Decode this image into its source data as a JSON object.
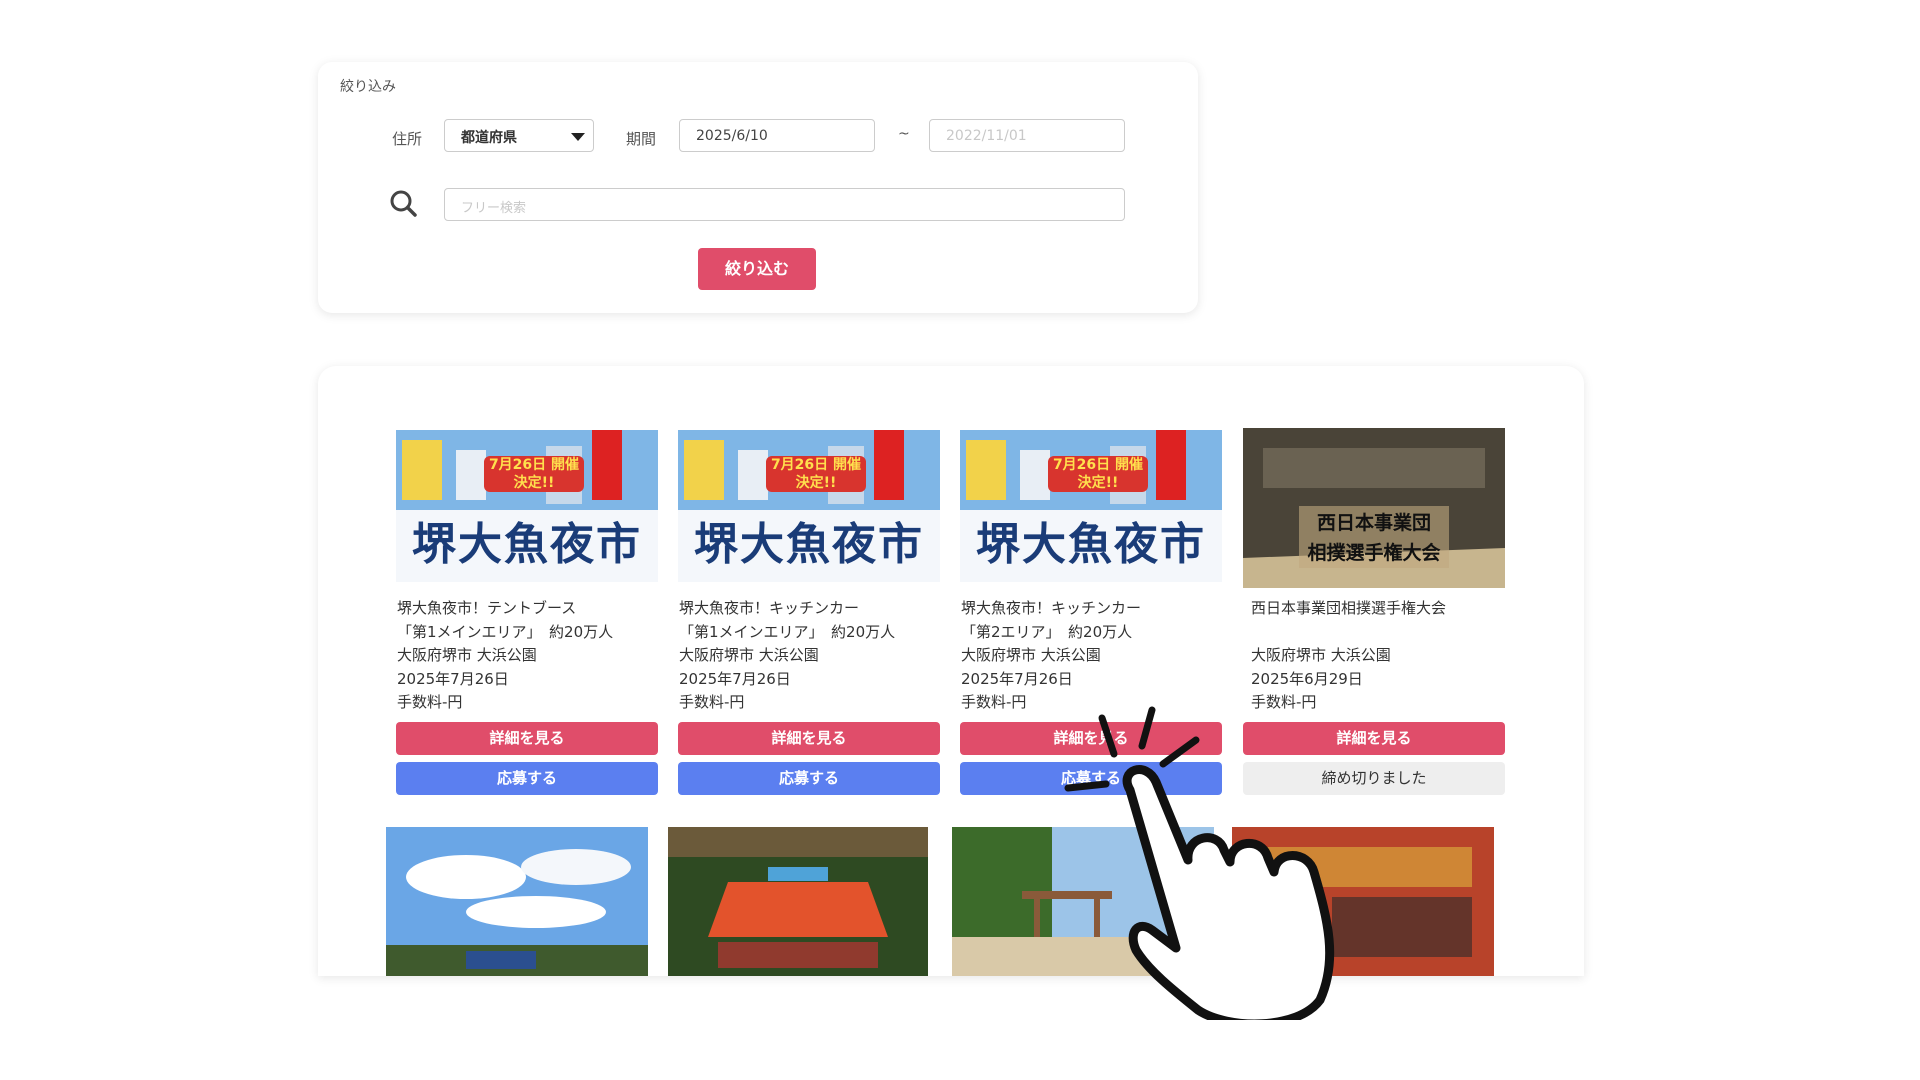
{
  "filter": {
    "title": "絞り込み",
    "address_label": "住所",
    "prefecture_value": "都道府県",
    "period_label": "期間",
    "date_from": "2025/6/10",
    "date_separator": "~",
    "date_to_placeholder": "2022/11/01",
    "search_placeholder": "フリー検索",
    "submit_label": "絞り込む"
  },
  "events": [
    {
      "poster_badge": "7月26日 開催決定!!",
      "poster_title": "堺大魚夜市",
      "lines": [
        "堺大魚夜市！テントブース",
        "「第1メインエリア」　約20万人",
        "大阪府堺市 大浜公園",
        "2025年7月26日",
        "手数料-円"
      ],
      "detail_label": "詳細を見る",
      "action_label": "応募する",
      "status": "open"
    },
    {
      "poster_badge": "7月26日 開催決定!!",
      "poster_title": "堺大魚夜市",
      "lines": [
        "堺大魚夜市！キッチンカー",
        "「第1メインエリア」　約20万人",
        "大阪府堺市 大浜公園",
        "2025年7月26日",
        "手数料-円"
      ],
      "detail_label": "詳細を見る",
      "action_label": "応募する",
      "status": "open"
    },
    {
      "poster_badge": "7月26日 開催決定!!",
      "poster_title": "堺大魚夜市",
      "lines": [
        "堺大魚夜市！キッチンカー",
        "「第2エリア」　約20万人",
        "大阪府堺市 大浜公園",
        "2025年7月26日",
        "手数料-円"
      ],
      "detail_label": "詳細を見る",
      "action_label": "応募する",
      "status": "open"
    },
    {
      "poster_line1": "西日本事業団",
      "poster_line2": "相撲選手権大会",
      "lines": [
        "西日本事業団相撲選手権大会",
        "",
        "大阪府堺市 大浜公園",
        "2025年6月29日",
        "手数料-円"
      ],
      "detail_label": "詳細を見る",
      "action_label": "締め切りました",
      "status": "closed"
    }
  ],
  "colors": {
    "primary_pink": "#e04d6a",
    "apply_blue": "#5b7ff0",
    "closed_gray": "#eeeeee"
  }
}
